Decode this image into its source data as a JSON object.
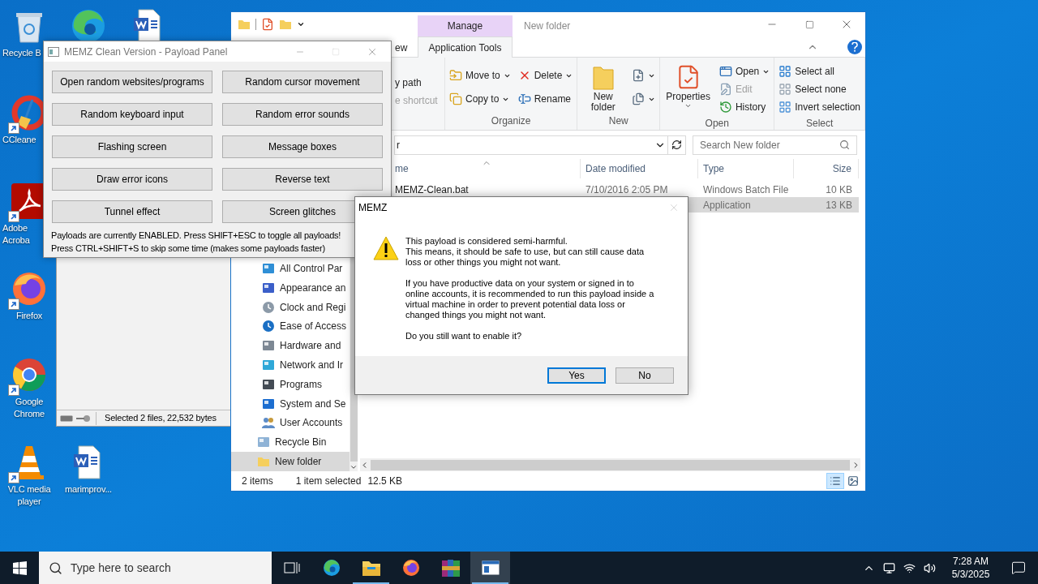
{
  "desktop_icons": [
    {
      "kind": "recycle_bin",
      "label": "Recycle B",
      "shortcut": false
    },
    {
      "kind": "edge"
    },
    {
      "kind": "word"
    },
    {
      "kind": "ccleaner",
      "label": "CCleane",
      "shortcut": true
    },
    {
      "kind": "acrobat",
      "label": "Adobe Acroba",
      "shortcut": true
    },
    {
      "kind": "firefox",
      "label": "Firefox",
      "shortcut": true
    },
    {
      "kind": "chrome",
      "label": "Google Chrome",
      "shortcut": true
    },
    {
      "kind": "vlc",
      "label": "VLC media player",
      "shortcut": true
    },
    {
      "kind": "word",
      "label": "marimprov...",
      "shortcut": false
    }
  ],
  "back_window": {
    "status": "Selected 2 files, 22,532 bytes"
  },
  "explorer": {
    "title": "New folder",
    "context_tab": {
      "group": "Manage",
      "label": "Application Tools",
      "selected": true
    },
    "tab_fragment": "ew",
    "ribbon": {
      "clipboard_fragments": [
        {
          "label": "y path",
          "disabled": false
        },
        {
          "label": "e shortcut",
          "disabled": true
        }
      ],
      "groups": [
        {
          "name": "Organize",
          "columns": [
            [
              {
                "kind": "move",
                "label": "Move to",
                "dropdown": true
              },
              {
                "kind": "copy",
                "label": "Copy to",
                "dropdown": true
              }
            ],
            [
              {
                "kind": "delete",
                "label": "Delete",
                "dropdown": true
              },
              {
                "kind": "rename",
                "label": "Rename",
                "dropdown": false
              }
            ]
          ]
        },
        {
          "name": "New",
          "columns": [
            [
              {
                "kind": "new_folder",
                "label": "New folder",
                "large": true,
                "dropdown": false
              }
            ],
            [
              {
                "kind": "new_item",
                "dropdown": true
              },
              {
                "kind": "easy_access",
                "dropdown": true
              }
            ]
          ]
        },
        {
          "name": "Open",
          "columns": [
            [
              {
                "kind": "properties",
                "label": "Properties",
                "large": true,
                "dropdown": true
              }
            ],
            [
              {
                "kind": "open",
                "label": "Open",
                "dropdown": true
              },
              {
                "kind": "edit",
                "label": "Edit",
                "disabled": true
              },
              {
                "kind": "history",
                "label": "History"
              }
            ]
          ]
        },
        {
          "name": "Select",
          "columns": [
            [
              {
                "kind": "select_all",
                "label": "Select all"
              },
              {
                "kind": "select_none",
                "label": "Select none"
              },
              {
                "kind": "invert",
                "label": "Invert selection"
              }
            ]
          ]
        }
      ]
    },
    "address_fragment": "r",
    "search_placeholder": "Search New folder",
    "columns": [
      {
        "label": "me",
        "sorted": true
      },
      {
        "label": "Date modified",
        "sorted": false
      },
      {
        "label": "Type",
        "sorted": false
      },
      {
        "label": "Size",
        "sorted": false
      }
    ],
    "rows": [
      {
        "name": "MEMZ-Clean.bat",
        "date": "7/10/2016 2:05 PM",
        "type": "Windows Batch File",
        "size": "10 KB",
        "selected": false
      },
      {
        "type": "Application",
        "size": "13 KB",
        "selected": true
      }
    ],
    "nav_pane": [
      {
        "children": [
          {
            "kind": "control_panel",
            "label": "All Control Par",
            "selected": false
          },
          {
            "kind": "appearance",
            "label": "Appearance an",
            "selected": false
          },
          {
            "kind": "clock",
            "label": "Clock and Regi",
            "selected": false
          },
          {
            "kind": "ease",
            "label": "Ease of Access",
            "selected": false
          },
          {
            "kind": "hardware",
            "label": "Hardware and",
            "selected": false
          },
          {
            "kind": "network",
            "label": "Network and Ir",
            "selected": false
          },
          {
            "kind": "programs",
            "label": "Programs",
            "selected": false
          },
          {
            "kind": "system",
            "label": "System and Se",
            "selected": false
          },
          {
            "kind": "users",
            "label": "User Accounts",
            "selected": false
          }
        ]
      },
      {
        "kind": "recycle",
        "label": "Recycle Bin",
        "selected": false
      },
      {
        "kind": "folder",
        "label": "New folder",
        "selected": true
      }
    ],
    "status": {
      "items": "2 items",
      "selection": "1 item selected",
      "size": "12.5 KB"
    },
    "views": [
      {
        "kind": "details",
        "selected": true
      },
      {
        "kind": "large_icons",
        "selected": false
      }
    ]
  },
  "memz_panel": {
    "title": "MEMZ Clean Version - Payload Panel",
    "buttons": [
      "Open random websites/programs",
      "Random cursor movement",
      "Random keyboard input",
      "Random error sounds",
      "Flashing screen",
      "Message boxes",
      "Draw error icons",
      "Reverse text",
      "Tunnel effect",
      "Screen glitches"
    ],
    "status_lines": [
      "Payloads are currently ENABLED. Press SHIFT+ESC to toggle all payloads!",
      "Press CTRL+SHIFT+S to skip some time (makes some payloads faster)"
    ]
  },
  "dialog": {
    "title": "MEMZ",
    "paragraphs": [
      [
        "This payload is considered semi-harmful.",
        "This means, it should be safe to use, but can still cause data loss or other things you might not want."
      ],
      [
        "If you have productive data on your system or signed in to online accounts, it is recommended to run this payload inside a virtual machine in order to prevent potential data loss or changed things you might not want."
      ],
      [
        "Do you still want to enable it?"
      ]
    ],
    "buttons": [
      {
        "label": "Yes",
        "focused": true
      },
      {
        "label": "No",
        "focused": false
      }
    ]
  },
  "taskbar": {
    "search_placeholder": "Type here to search",
    "apps": [
      {
        "kind": "task_view",
        "running": false,
        "selected": false
      },
      {
        "kind": "edge",
        "running": false,
        "selected": false
      },
      {
        "kind": "explorer",
        "running": true,
        "selected": false
      },
      {
        "kind": "firefox",
        "running": false,
        "selected": false
      },
      {
        "kind": "winrar",
        "running": false,
        "selected": false
      },
      {
        "kind": "memz",
        "running": true,
        "selected": true
      }
    ],
    "time": "7:28 AM",
    "date": "5/3/2025"
  }
}
